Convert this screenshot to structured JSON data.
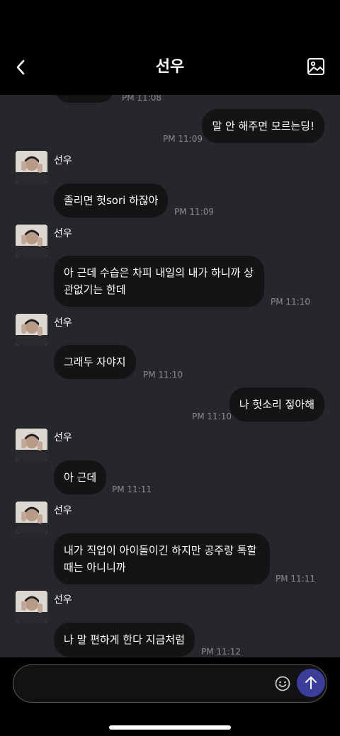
{
  "header": {
    "title": "선우"
  },
  "contact": {
    "name": "선우"
  },
  "messages": [
    {
      "id": "m0",
      "time": "PM 11:08"
    },
    {
      "id": "m1",
      "text": "말 안 해주면 모르는딩!",
      "time": "PM 11:09"
    },
    {
      "id": "m2",
      "text": "졸리면 헛sori 하잖아",
      "time": "PM 11:09"
    },
    {
      "id": "m3",
      "text": "아 근데 수습은 차피 내일의 내가 하니까 상관없기는 한데",
      "time": "PM 11:10"
    },
    {
      "id": "m4",
      "text": "그래두 자야지",
      "time": "PM 11:10"
    },
    {
      "id": "m5",
      "text": "나 헛소리 젛아해",
      "time": "PM 11:10"
    },
    {
      "id": "m6",
      "text": "아 근데",
      "time": "PM 11:11"
    },
    {
      "id": "m7",
      "text": "내가 직업이 아이돌이긴 하지만 공주랑 톡할 때는 아니니까",
      "time": "PM 11:11"
    },
    {
      "id": "m8",
      "text": "나 말 편하게 한다 지금처럼",
      "time": "PM 11:12"
    }
  ],
  "composer": {
    "value": "",
    "placeholder": ""
  },
  "icons": {
    "back": "chevron-left-icon",
    "image": "image-icon",
    "emoji": "emoji-icon",
    "send": "arrow-up-icon"
  },
  "colors": {
    "send_button": "#3b3d9a",
    "bubble": "#141416",
    "chat_bg": "#26272b"
  }
}
